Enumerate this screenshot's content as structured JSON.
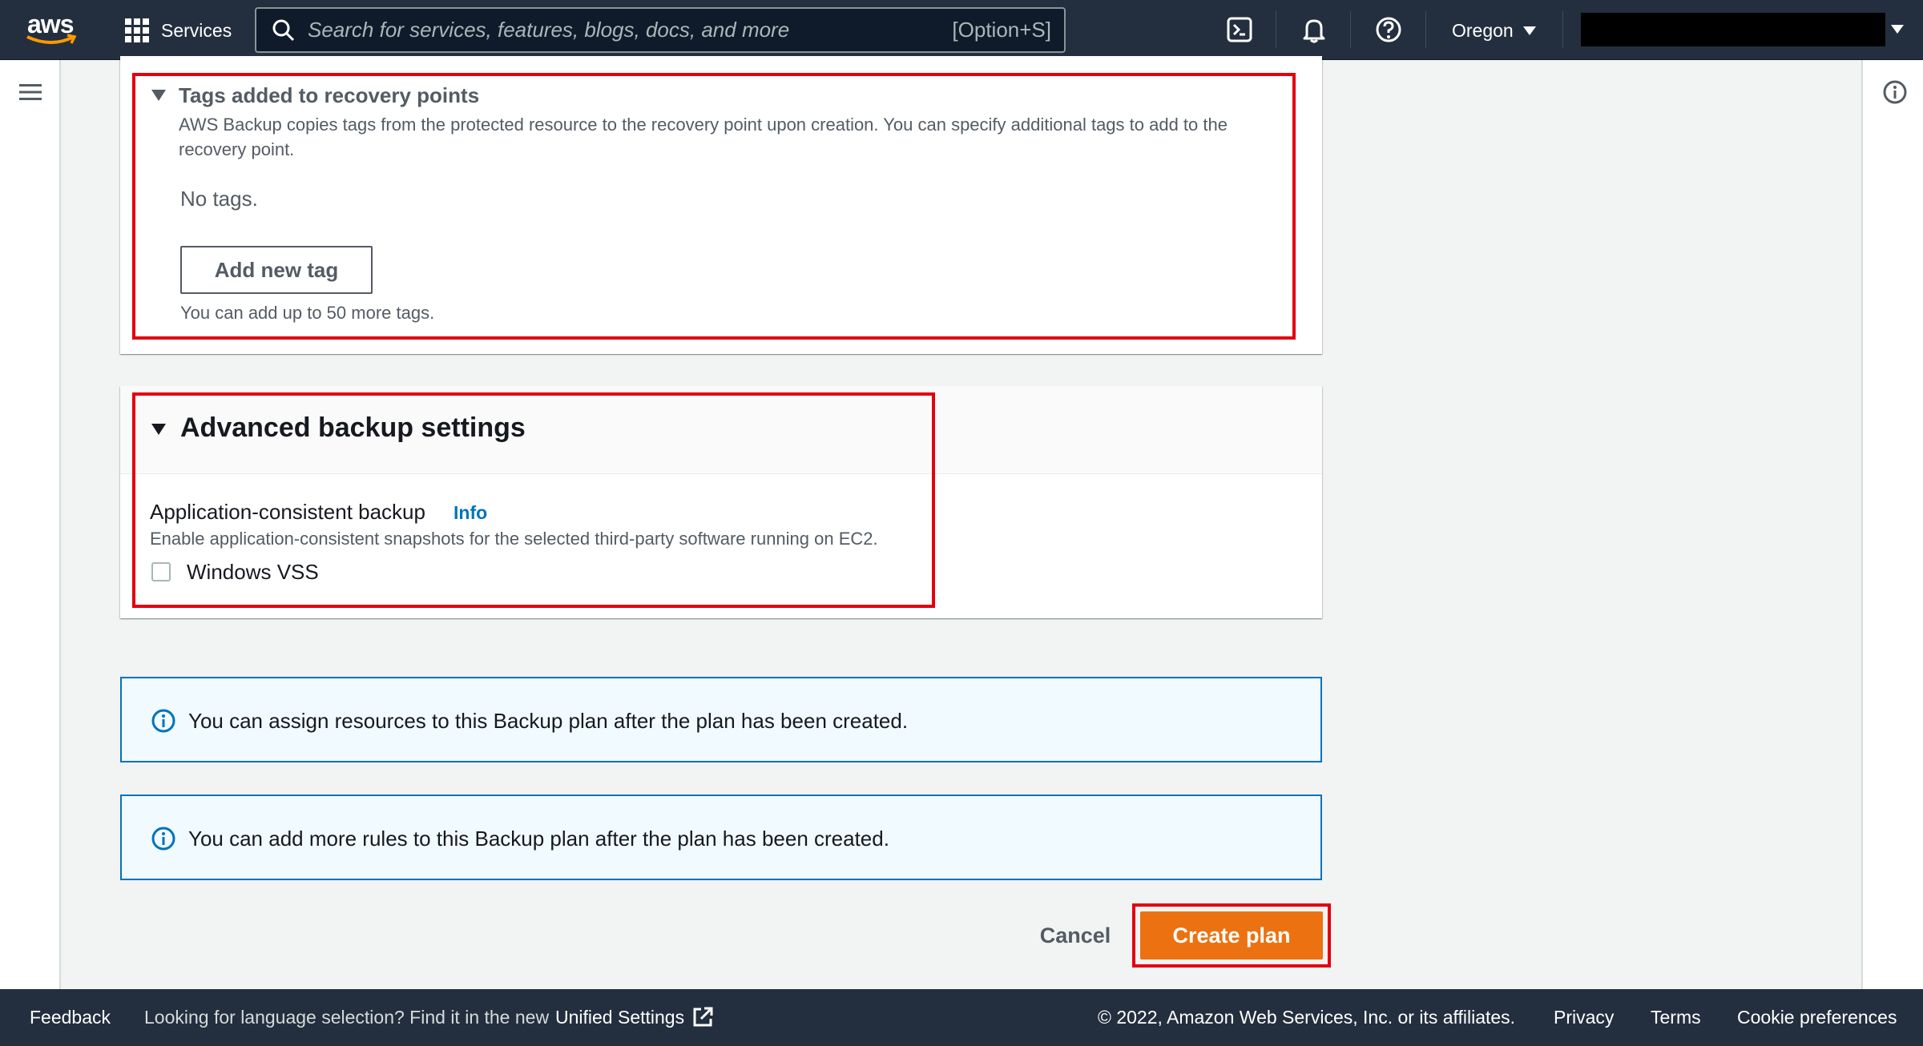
{
  "nav": {
    "logo": "aws",
    "services_label": "Services",
    "search_placeholder": "Search for services, features, blogs, docs, and more",
    "search_shortcut": "[Option+S]",
    "region": "Oregon",
    "icons": [
      "cloudshell-icon",
      "bell-icon",
      "help-icon"
    ]
  },
  "tags_section": {
    "title": "Tags added to recovery points",
    "description": "AWS Backup copies tags from the protected resource to the recovery point upon creation. You can specify additional tags to add to the recovery point.",
    "empty_text": "No tags.",
    "add_button": "Add new tag",
    "limit_text": "You can add up to 50 more tags."
  },
  "advanced": {
    "title": "Advanced backup settings",
    "field_label": "Application-consistent backup",
    "info_link": "Info",
    "field_description": "Enable application-consistent snapshots for the selected third-party software running on EC2.",
    "checkbox_label": "Windows VSS",
    "checkbox_checked": false
  },
  "alerts": [
    "You can assign resources to this Backup plan after the plan has been created.",
    "You can add more rules to this Backup plan after the plan has been created."
  ],
  "actions": {
    "cancel": "Cancel",
    "create": "Create plan"
  },
  "footer": {
    "feedback": "Feedback",
    "language_text": "Looking for language selection? Find it in the new",
    "unified_settings": "Unified Settings",
    "copyright": "© 2022, Amazon Web Services, Inc. or its affiliates.",
    "privacy": "Privacy",
    "terms": "Terms",
    "cookie": "Cookie preferences"
  },
  "colors": {
    "nav_bg": "#232f3e",
    "primary_button": "#ec7211",
    "highlight": "#e3000f",
    "info_blue": "#0073bb"
  }
}
